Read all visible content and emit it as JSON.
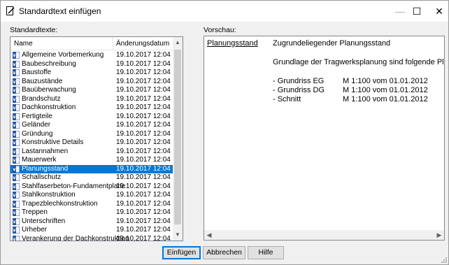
{
  "window": {
    "title": "Standardtext einfügen",
    "minimize_glyph": "—",
    "maximize_glyph": "☐",
    "close_glyph": "✕"
  },
  "left_label": "Standardtexte:",
  "right_label": "Vorschau:",
  "list": {
    "columns": [
      "Name",
      "Änderungsdatum"
    ],
    "selected_index": 18,
    "rows": [
      {
        "name": "Allgemeine Vorbemerkung",
        "date": "19.10.2017 12:04"
      },
      {
        "name": "Baubeschreibung",
        "date": "19.10.2017 12:04"
      },
      {
        "name": "Baustoffe",
        "date": "19.10.2017 12:04"
      },
      {
        "name": "Bauzustände",
        "date": "19.10.2017 12:04"
      },
      {
        "name": "Bauüberwachung",
        "date": "19.10.2017 12:04"
      },
      {
        "name": "Brandschutz",
        "date": "19.10.2017 12:04"
      },
      {
        "name": "Dachkonstruktion",
        "date": "19.10.2017 12:04"
      },
      {
        "name": "Fertigteile",
        "date": "19.10.2017 12:04"
      },
      {
        "name": "Geländer",
        "date": "19.10.2017 12:04"
      },
      {
        "name": "Gründung",
        "date": "19.10.2017 12:04"
      },
      {
        "name": "Konstruktive Details",
        "date": "19.10.2017 12:04"
      },
      {
        "name": "Lastannahmen",
        "date": "19.10.2017 12:04"
      },
      {
        "name": "Mauerwerk",
        "date": "19.10.2017 12:04"
      },
      {
        "name": "Planungsstand",
        "date": "19.10.2017 12:04"
      },
      {
        "name": "Schallschutz",
        "date": "19.10.2017 12:04"
      },
      {
        "name": "Stahlfaserbeton-Fundamentplatte",
        "date": "19.10.2017 12:04"
      },
      {
        "name": "Stahlkonstruktion",
        "date": "19.10.2017 12:04"
      },
      {
        "name": "Trapezblechkonstruktion",
        "date": "19.10.2017 12:04"
      },
      {
        "name": "Treppen",
        "date": "19.10.2017 12:04"
      },
      {
        "name": "Unterschriften",
        "date": "19.10.2017 12:04"
      },
      {
        "name": "Urheber",
        "date": "19.10.2017 12:04"
      },
      {
        "name": "Verankerung der Dachkonstruktion",
        "date": "19.10.2017 12:04"
      }
    ]
  },
  "preview": {
    "heading": "Planungsstand",
    "title": "Zugrundeliegender Planungsstand",
    "intro": "Grundlage der Tragwerksplanung sind folgende Pläne",
    "items": [
      {
        "label": "- Grundriss EG",
        "detail": "M 1:100 vom 01.01.2012"
      },
      {
        "label": "- Grundriss DG",
        "detail": "M 1:100 vom 01.01.2012"
      },
      {
        "label": "- Schnitt",
        "detail": "M 1:100 vom 01.01.2012"
      }
    ]
  },
  "buttons": {
    "insert": "Einfügen",
    "cancel": "Abbrechen",
    "help": "Hilfe"
  },
  "colors": {
    "selection": "#0078d7",
    "doc_icon": "#2b579a"
  }
}
